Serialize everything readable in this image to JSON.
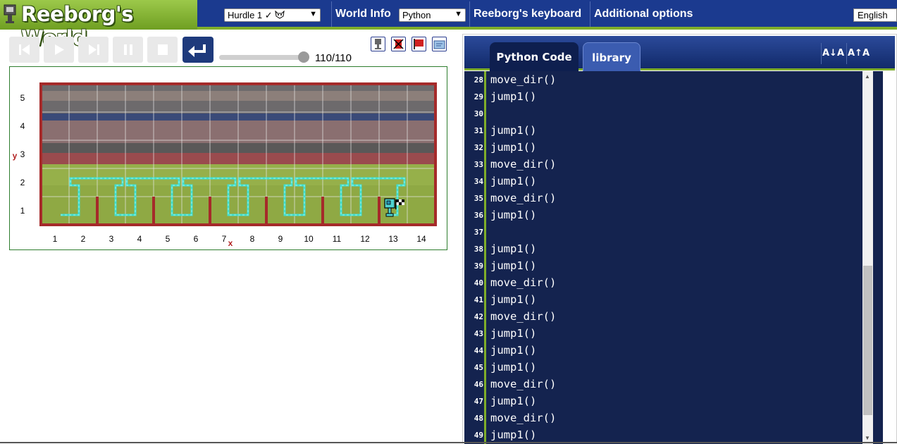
{
  "app": {
    "title": "Reeborg's World"
  },
  "header": {
    "world_select": "Hurdle 1 ✓",
    "world_info": "World Info",
    "language_select": "Python",
    "keyboard": "Reeborg's keyboard",
    "additional_options": "Additional options",
    "ui_language": "English"
  },
  "controls": {
    "step_counter": "110/110",
    "progress": 1.0
  },
  "world": {
    "x_axis_label": "x",
    "y_axis_label": "y",
    "x_ticks": [
      "1",
      "2",
      "3",
      "4",
      "5",
      "6",
      "7",
      "8",
      "9",
      "10",
      "11",
      "12",
      "13",
      "14"
    ],
    "y_ticks": [
      "1",
      "2",
      "3",
      "4",
      "5"
    ],
    "robot_position": [
      13,
      1
    ],
    "goal_position": [
      13,
      1
    ],
    "walls_east_of_x": [
      2,
      4,
      6,
      8,
      10,
      12
    ],
    "wall_color": "#a52a2a",
    "trace_color": "#40e0d0"
  },
  "editor": {
    "tabs": [
      "Python Code",
      "library"
    ],
    "font_decrease": "A↓A",
    "font_increase": "A↑A",
    "lines": [
      {
        "n": "28",
        "code": "move_dir()"
      },
      {
        "n": "29",
        "code": "jump1()"
      },
      {
        "n": "30",
        "code": ""
      },
      {
        "n": "31",
        "code": "jump1()"
      },
      {
        "n": "32",
        "code": "jump1()"
      },
      {
        "n": "33",
        "code": "move_dir()"
      },
      {
        "n": "34",
        "code": "jump1()"
      },
      {
        "n": "35",
        "code": "move_dir()"
      },
      {
        "n": "36",
        "code": "jump1()"
      },
      {
        "n": "37",
        "code": ""
      },
      {
        "n": "38",
        "code": "jump1()"
      },
      {
        "n": "39",
        "code": "jump1()"
      },
      {
        "n": "40",
        "code": "move_dir()"
      },
      {
        "n": "41",
        "code": "jump1()"
      },
      {
        "n": "42",
        "code": "move_dir()"
      },
      {
        "n": "43",
        "code": "jump1()"
      },
      {
        "n": "44",
        "code": "jump1()"
      },
      {
        "n": "45",
        "code": "jump1()"
      },
      {
        "n": "46",
        "code": "move_dir()"
      },
      {
        "n": "47",
        "code": "jump1()"
      },
      {
        "n": "48",
        "code": "move_dir()"
      },
      {
        "n": "49",
        "code": "jump1()"
      }
    ]
  }
}
